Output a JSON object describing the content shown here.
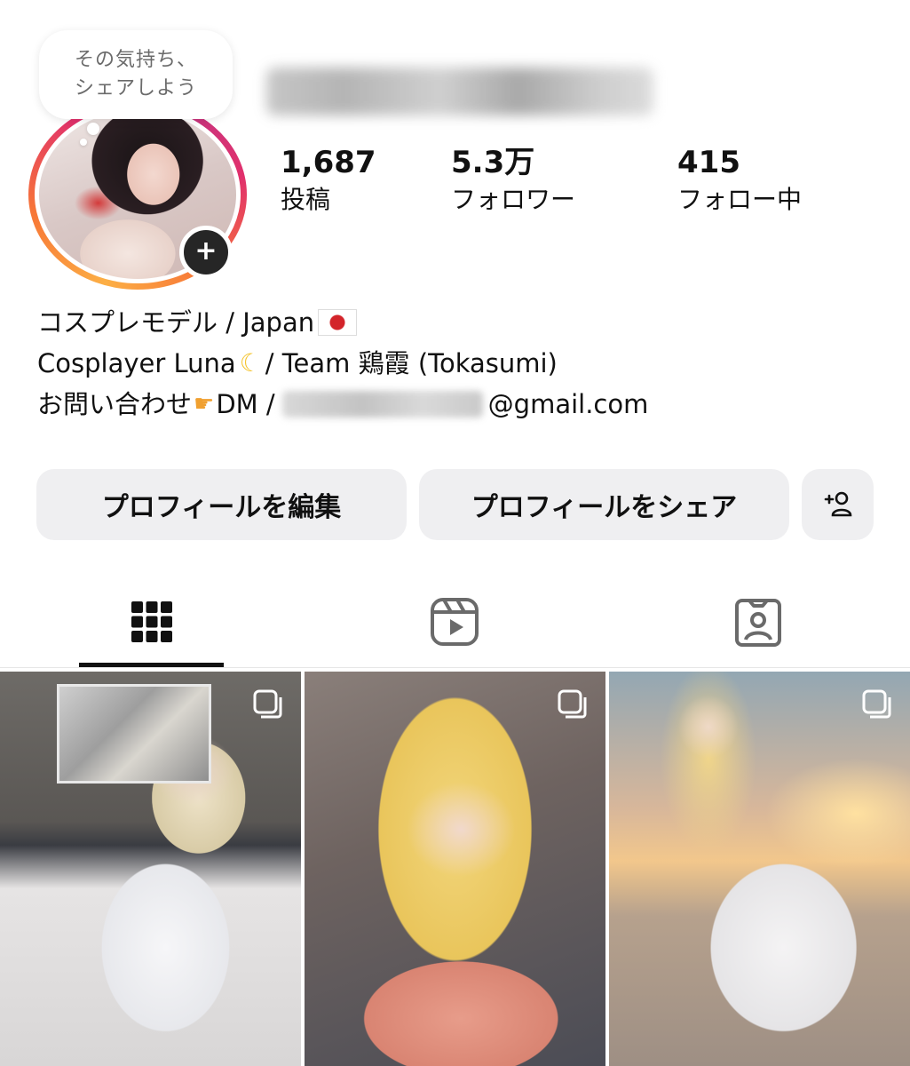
{
  "note": {
    "line1": "その気持ち、",
    "line2": "シェアしよう"
  },
  "profile": {
    "add_story_symbol": "+",
    "stats": {
      "posts": {
        "value": "1,687",
        "label": "投稿"
      },
      "followers": {
        "value": "5.3万",
        "label": "フォロワー"
      },
      "following": {
        "value": "415",
        "label": "フォロー中"
      }
    }
  },
  "bio": {
    "line1": "コスプレモデル / Japan",
    "line2_a": "Cosplayer Luna",
    "line2_b": " / Team 鶏霞 (Tokasumi)",
    "line3_a": "お問い合わせ",
    "line3_b": "DM / ",
    "line3_c": "@gmail.com"
  },
  "buttons": {
    "edit_profile": "プロフィールを編集",
    "share_profile": "プロフィールをシェア"
  },
  "tabs": [
    {
      "name": "grid",
      "icon": "grid-icon",
      "active": true
    },
    {
      "name": "reels",
      "icon": "reels-icon",
      "active": false
    },
    {
      "name": "tagged",
      "icon": "tagged-icon",
      "active": false
    }
  ],
  "posts": [
    {
      "type": "carousel",
      "icon": "multiple-posts-icon"
    },
    {
      "type": "carousel",
      "icon": "multiple-posts-icon"
    },
    {
      "type": "carousel",
      "icon": "multiple-posts-icon"
    }
  ],
  "colors": {
    "button_bg": "#efeff1",
    "story_ring_start": "#fcaf45",
    "story_ring_mid": "#e1306c",
    "story_ring_end": "#c13584",
    "text": "#111111",
    "secondary_text": "#6b6b6b"
  }
}
